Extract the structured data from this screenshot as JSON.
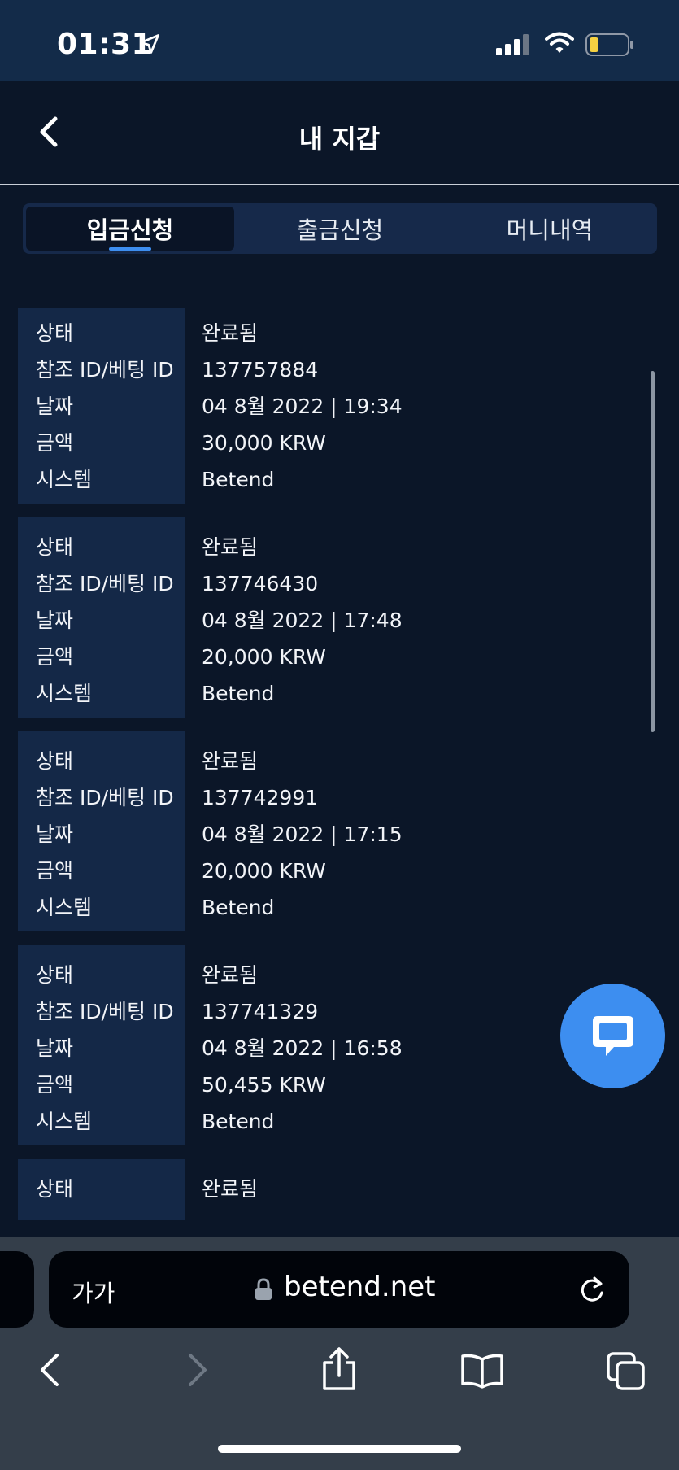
{
  "status_bar": {
    "time": "01:31"
  },
  "header": {
    "title": "내 지갑"
  },
  "tabs": [
    {
      "label": "입금신청",
      "active": true
    },
    {
      "label": "출금신청",
      "active": false
    },
    {
      "label": "머니내역",
      "active": false
    }
  ],
  "records": [
    {
      "rows": [
        {
          "key": "상태",
          "value": "완료됨"
        },
        {
          "key": "참조 ID/베팅 ID",
          "value": "137757884"
        },
        {
          "key": "날짜",
          "value": "04 8월 2022 | 19:34"
        },
        {
          "key": "금액",
          "value": "30,000 KRW"
        },
        {
          "key": "시스템",
          "value": "Betend"
        }
      ]
    },
    {
      "rows": [
        {
          "key": "상태",
          "value": "완료됨"
        },
        {
          "key": "참조 ID/베팅 ID",
          "value": "137746430"
        },
        {
          "key": "날짜",
          "value": "04 8월 2022 | 17:48"
        },
        {
          "key": "금액",
          "value": "20,000 KRW"
        },
        {
          "key": "시스템",
          "value": "Betend"
        }
      ]
    },
    {
      "rows": [
        {
          "key": "상태",
          "value": "완료됨"
        },
        {
          "key": "참조 ID/베팅 ID",
          "value": "137742991"
        },
        {
          "key": "날짜",
          "value": "04 8월 2022 | 17:15"
        },
        {
          "key": "금액",
          "value": "20,000 KRW"
        },
        {
          "key": "시스템",
          "value": "Betend"
        }
      ]
    },
    {
      "rows": [
        {
          "key": "상태",
          "value": "완료됨"
        },
        {
          "key": "참조 ID/베팅 ID",
          "value": "137741329"
        },
        {
          "key": "날짜",
          "value": "04 8월 2022 | 16:58"
        },
        {
          "key": "금액",
          "value": "50,455 KRW"
        },
        {
          "key": "시스템",
          "value": "Betend"
        }
      ]
    },
    {
      "rows": [
        {
          "key": "상태",
          "value": "완료됨"
        }
      ]
    }
  ],
  "browser": {
    "aa_label": "가가",
    "url": "betend.net"
  },
  "icons": {
    "location": "location-arrow-icon",
    "signal": "cellular-signal-icon",
    "wifi": "wifi-icon",
    "battery": "battery-low-icon",
    "back": "chevron-left-icon",
    "chat": "chat-bubble-icon",
    "lock": "lock-icon",
    "reload": "reload-icon",
    "nav_back": "chevron-left-icon",
    "nav_forward": "chevron-right-icon",
    "share": "share-icon",
    "bookmarks": "book-icon",
    "tabs": "tabs-icon"
  },
  "colors": {
    "background": "#0b1628",
    "panel": "#142847",
    "accent": "#3d8ef0",
    "battery_fill": "#f5d142"
  }
}
